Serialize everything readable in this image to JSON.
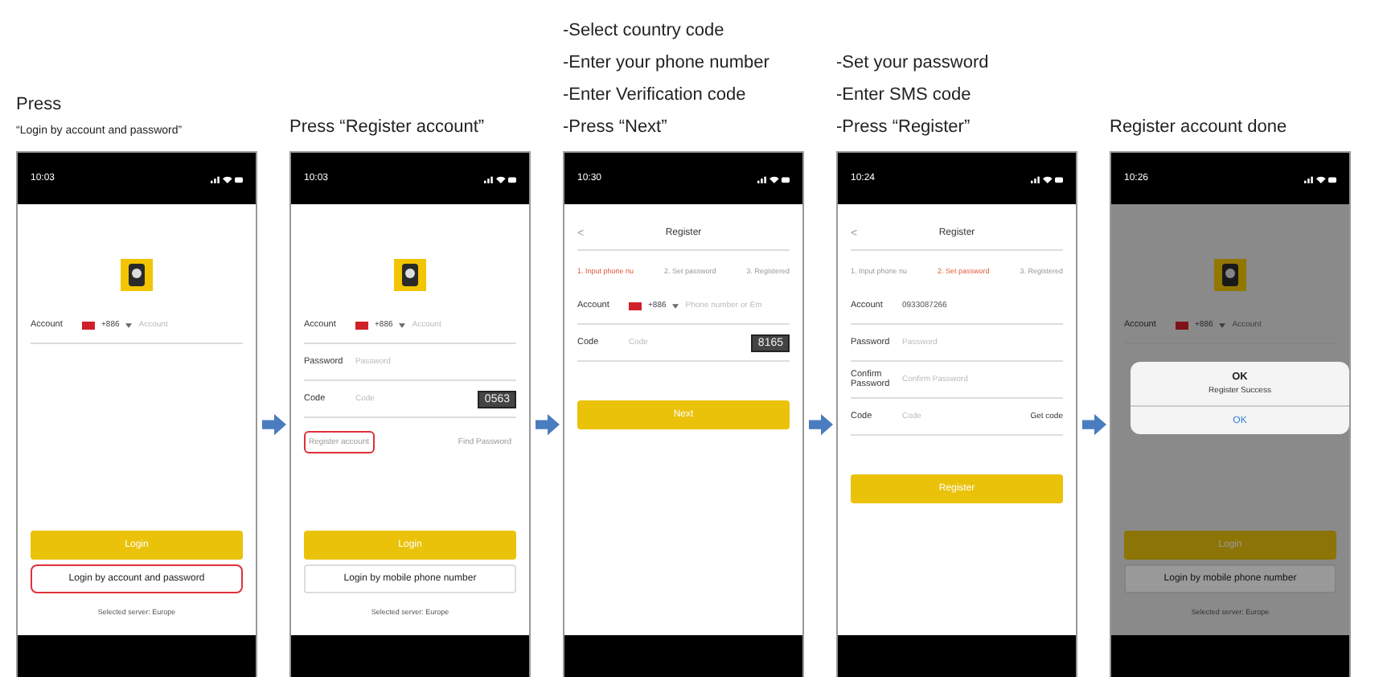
{
  "steps": [
    {
      "caption": [
        {
          "kind": "line",
          "text": "Press"
        },
        {
          "kind": "quote",
          "text": "“Login by account and password”"
        }
      ],
      "phone": {
        "time": "10:03",
        "dimmed": false,
        "top": [
          {
            "kind": "logo"
          },
          {
            "kind": "account",
            "label": "Account",
            "code": "+886",
            "placeholder": "Account"
          }
        ],
        "bottom": [
          {
            "kind": "primary",
            "label": "Login"
          },
          {
            "kind": "outline",
            "label": "Login by account and password",
            "highlighted": true
          },
          {
            "kind": "server",
            "text": "Selected server: Europe"
          }
        ]
      }
    },
    {
      "caption": [
        {
          "kind": "line",
          "text": "Press “Register account”"
        }
      ],
      "phone": {
        "time": "10:03",
        "dimmed": false,
        "top": [
          {
            "kind": "logo"
          },
          {
            "kind": "account",
            "label": "Account",
            "code": "+886",
            "placeholder": "Account"
          },
          {
            "kind": "field",
            "label": "Password",
            "placeholder": "Password"
          },
          {
            "kind": "field",
            "label": "Code",
            "placeholder": "Code",
            "captcha": "0563"
          },
          {
            "kind": "links",
            "left": "Register account",
            "right": "Find Password",
            "highlighted": true
          }
        ],
        "bottom": [
          {
            "kind": "primary",
            "label": "Login"
          },
          {
            "kind": "outline",
            "label": "Login by mobile phone number",
            "highlighted": false
          },
          {
            "kind": "server",
            "text": "Selected server: Europe"
          }
        ]
      }
    },
    {
      "caption": [
        {
          "kind": "line",
          "text": "-Select country code"
        },
        {
          "kind": "line",
          "text": "-Enter your phone number"
        },
        {
          "kind": "line",
          "text": "-Enter Verification code"
        },
        {
          "kind": "line",
          "text": "-Press “Next”"
        }
      ],
      "phone": {
        "time": "10:30",
        "dimmed": false,
        "top": [
          {
            "kind": "nav",
            "back": "<",
            "title": "Register"
          },
          {
            "kind": "steps",
            "items": [
              {
                "text": "1. Input phone nu",
                "selected": true
              },
              {
                "text": "2. Set password",
                "selected": false
              },
              {
                "text": "3. Registered",
                "selected": false
              }
            ]
          },
          {
            "kind": "account",
            "label": "Account",
            "code": "+886",
            "placeholder": "Phone number or Em"
          },
          {
            "kind": "field",
            "label": "Code",
            "placeholder": "Code",
            "captcha": "8165"
          },
          {
            "kind": "primary",
            "label": "Next"
          }
        ]
      }
    },
    {
      "caption": [
        {
          "kind": "line",
          "text": "-Set your password"
        },
        {
          "kind": "line",
          "text": "-Enter SMS code"
        },
        {
          "kind": "line",
          "text": "-Press “Register”"
        }
      ],
      "phone": {
        "time": "10:24",
        "dimmed": false,
        "top": [
          {
            "kind": "nav",
            "back": "<",
            "title": "Register"
          },
          {
            "kind": "steps",
            "items": [
              {
                "text": "1. Input phone nu",
                "selected": false
              },
              {
                "text": "2. Set password",
                "selected": true
              },
              {
                "text": "3. Registered",
                "selected": false
              }
            ]
          },
          {
            "kind": "field",
            "label": "Account",
            "value": "0933087266"
          },
          {
            "kind": "field",
            "label": "Password",
            "placeholder": "Password"
          },
          {
            "kind": "field",
            "label": "Confirm Password",
            "placeholder": "Confirm Password"
          },
          {
            "kind": "field",
            "label": "Code",
            "placeholder": "Code",
            "action": "Get code"
          },
          {
            "kind": "primary",
            "label": "Register"
          }
        ]
      }
    },
    {
      "caption": [
        {
          "kind": "line",
          "text": "Register account done"
        }
      ],
      "phone": {
        "time": "10:26",
        "dimmed": true,
        "top": [
          {
            "kind": "logo"
          },
          {
            "kind": "account",
            "label": "Account",
            "code": "+886",
            "placeholder": "Account"
          }
        ],
        "bottom": [
          {
            "kind": "primary",
            "label": "Login"
          },
          {
            "kind": "outline",
            "label": "Login by mobile phone number",
            "highlighted": false
          },
          {
            "kind": "server",
            "text": "Selected server: Europe"
          }
        ],
        "dialog": {
          "title": "OK",
          "message": "Register Success",
          "button": "OK"
        }
      }
    }
  ]
}
